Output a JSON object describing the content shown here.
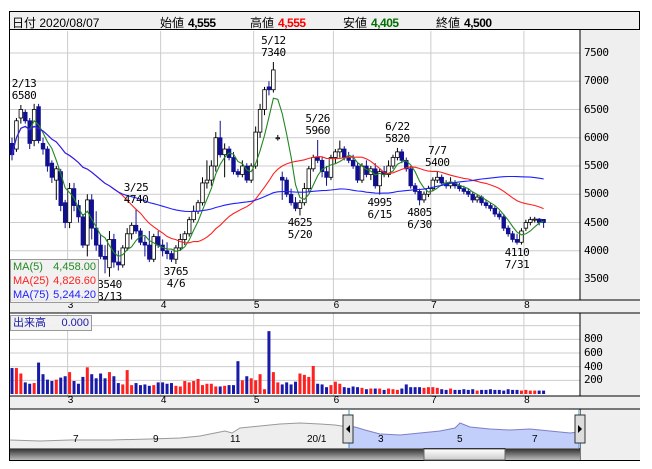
{
  "header": {
    "date_label": "日付",
    "date": "2020/08/07",
    "open_label": "始値",
    "open": "4,555",
    "high_label": "高値",
    "high": "4,555",
    "low_label": "安値",
    "low": "4,405",
    "close_label": "終値",
    "close": "4,500"
  },
  "colors": {
    "up_volume": "#ff2020",
    "down_volume": "#1a1aa8",
    "down_candle": "#101090",
    "ma5": "#228822",
    "ma25": "#ff2020",
    "ma75": "#2020ff",
    "high_text": "#ff0000",
    "low_text": "#007000"
  },
  "ma_legend": [
    {
      "label": "MA(5)",
      "value": "4,458.00"
    },
    {
      "label": "MA(25)",
      "value": "4,826.60"
    },
    {
      "label": "MA(75)",
      "value": "5,244.20"
    }
  ],
  "volume_legend": {
    "label": "出来高",
    "value": "0.000"
  },
  "navigator": {
    "labels": [
      "7",
      "9",
      "11",
      "20/1",
      "3",
      "5",
      "7"
    ]
  },
  "chart_data": {
    "type": "candlestick",
    "price_ticks": [
      "3500",
      "4000",
      "4500",
      "5000",
      "5500",
      "6000",
      "6500",
      "7000",
      "7500"
    ],
    "ylim": [
      3500,
      7500
    ],
    "volume_ticks": [
      "200",
      "400",
      "600",
      "800"
    ],
    "volume_ylim": [
      0,
      900
    ],
    "months": [
      {
        "label": "3",
        "start_index": 13
      },
      {
        "label": "4",
        "start_index": 34
      },
      {
        "label": "5",
        "start_index": 55
      },
      {
        "label": "6",
        "start_index": 73
      },
      {
        "label": "7",
        "start_index": 95
      },
      {
        "label": "8",
        "start_index": 116
      }
    ],
    "ma_periods": [
      5,
      25,
      75
    ],
    "ohlcv_fields": [
      "open",
      "high",
      "low",
      "close",
      "volume"
    ],
    "ohlcv": [
      [
        5900,
        6000,
        5600,
        5700,
        380
      ],
      [
        5800,
        6350,
        5750,
        6300,
        380
      ],
      [
        6350,
        6580,
        6250,
        6500,
        300
      ],
      [
        6450,
        6500,
        6250,
        6300,
        170
      ],
      [
        6300,
        6350,
        5800,
        5900,
        150
      ],
      [
        5950,
        6600,
        5850,
        6500,
        160
      ],
      [
        6550,
        6600,
        5900,
        5950,
        460
      ],
      [
        5900,
        6000,
        5700,
        5800,
        290
      ],
      [
        5800,
        5850,
        5400,
        5500,
        210
      ],
      [
        5550,
        5600,
        5200,
        5300,
        190
      ],
      [
        5250,
        5500,
        4900,
        5450,
        210
      ],
      [
        5400,
        5450,
        4700,
        4800,
        240
      ],
      [
        4850,
        4900,
        4400,
        4500,
        260
      ],
      [
        4500,
        5200,
        4400,
        5100,
        320
      ],
      [
        5100,
        5200,
        4700,
        4800,
        190
      ],
      [
        4800,
        4900,
        4500,
        4600,
        150
      ],
      [
        4600,
        4650,
        4050,
        4100,
        250
      ],
      [
        4100,
        5000,
        3900,
        4900,
        390
      ],
      [
        4900,
        5000,
        4200,
        4400,
        290
      ],
      [
        4400,
        4700,
        4000,
        4100,
        230
      ],
      [
        4100,
        4300,
        3850,
        3900,
        300
      ],
      [
        3900,
        4100,
        3600,
        3850,
        230
      ],
      [
        3700,
        4350,
        3540,
        4200,
        320
      ],
      [
        4200,
        4300,
        3700,
        3800,
        260
      ],
      [
        3800,
        4000,
        3650,
        3750,
        160
      ],
      [
        3750,
        4100,
        3700,
        4050,
        140
      ],
      [
        4050,
        4400,
        4000,
        4300,
        350
      ],
      [
        4300,
        4500,
        4200,
        4450,
        130
      ],
      [
        4450,
        4740,
        4300,
        4350,
        160
      ],
      [
        4350,
        4400,
        4100,
        4150,
        130
      ],
      [
        4150,
        4250,
        3900,
        4100,
        140
      ],
      [
        4100,
        4350,
        3800,
        3850,
        120
      ],
      [
        3850,
        4300,
        3800,
        4250,
        130
      ],
      [
        4250,
        4350,
        4050,
        4100,
        170
      ],
      [
        4100,
        4200,
        3900,
        4000,
        170
      ],
      [
        4000,
        4150,
        3850,
        3950,
        150
      ],
      [
        3950,
        4000,
        3800,
        3850,
        160
      ],
      [
        3850,
        4100,
        3765,
        4050,
        120
      ],
      [
        4050,
        4300,
        4000,
        4200,
        110
      ],
      [
        4200,
        4350,
        4100,
        4300,
        190
      ],
      [
        4300,
        4600,
        4250,
        4550,
        170
      ],
      [
        4550,
        4800,
        4500,
        4700,
        190
      ],
      [
        4700,
        4900,
        4650,
        4850,
        220
      ],
      [
        4850,
        5300,
        4800,
        5200,
        130
      ],
      [
        5200,
        5600,
        5100,
        5250,
        150
      ],
      [
        5250,
        5600,
        5150,
        5500,
        150
      ],
      [
        5500,
        6100,
        5400,
        6000,
        110
      ],
      [
        6000,
        6300,
        5650,
        5700,
        110
      ],
      [
        5700,
        5900,
        5300,
        5800,
        120
      ],
      [
        5800,
        5850,
        5600,
        5650,
        130
      ],
      [
        5650,
        5750,
        5350,
        5400,
        130
      ],
      [
        5400,
        5450,
        5300,
        5350,
        480
      ],
      [
        5350,
        5600,
        5300,
        5500,
        200
      ],
      [
        5500,
        5550,
        5200,
        5250,
        260
      ],
      [
        5250,
        5550,
        5200,
        5500,
        230
      ],
      [
        5500,
        6200,
        5450,
        6100,
        200
      ],
      [
        6100,
        6600,
        6000,
        6500,
        290
      ],
      [
        6500,
        6900,
        6400,
        6850,
        70
      ],
      [
        6900,
        7000,
        6750,
        6850,
        920
      ],
      [
        6850,
        7340,
        6800,
        7200,
        320
      ],
      [
        6000,
        6050,
        5950,
        6000,
        170
      ],
      [
        5300,
        5400,
        4900,
        5250,
        140
      ],
      [
        5250,
        5300,
        4950,
        5000,
        170
      ],
      [
        5000,
        5100,
        4800,
        4850,
        140
      ],
      [
        4850,
        4950,
        4700,
        4750,
        180
      ],
      [
        4750,
        4900,
        4625,
        4850,
        300
      ],
      [
        4850,
        5200,
        4800,
        5100,
        280
      ],
      [
        5100,
        5500,
        5050,
        5450,
        250
      ],
      [
        5450,
        5700,
        5400,
        5650,
        410
      ],
      [
        5650,
        5960,
        5550,
        5600,
        150
      ],
      [
        5600,
        5650,
        5300,
        5400,
        140
      ],
      [
        5400,
        5500,
        5150,
        5300,
        100
      ],
      [
        5300,
        5700,
        5250,
        5650,
        130
      ],
      [
        5650,
        5800,
        5550,
        5750,
        180
      ],
      [
        5750,
        5950,
        5650,
        5800,
        150
      ],
      [
        5800,
        5850,
        5600,
        5650,
        100
      ],
      [
        5650,
        5750,
        5550,
        5600,
        90
      ],
      [
        5600,
        5700,
        5450,
        5500,
        110
      ],
      [
        5500,
        5550,
        5200,
        5250,
        100
      ],
      [
        5250,
        5550,
        5200,
        5500,
        90
      ],
      [
        5500,
        5600,
        5300,
        5350,
        70
      ],
      [
        5350,
        5500,
        5250,
        5450,
        80
      ],
      [
        5450,
        5550,
        5100,
        5150,
        80
      ],
      [
        5150,
        5450,
        4995,
        5400,
        80
      ],
      [
        5400,
        5500,
        5300,
        5350,
        60
      ],
      [
        5350,
        5600,
        5300,
        5500,
        80
      ],
      [
        5500,
        5700,
        5450,
        5650,
        70
      ],
      [
        5650,
        5820,
        5600,
        5750,
        60
      ],
      [
        5750,
        5800,
        5550,
        5600,
        80
      ],
      [
        5600,
        5650,
        5400,
        5450,
        140
      ],
      [
        5450,
        5500,
        5100,
        5150,
        100
      ],
      [
        5150,
        5200,
        5000,
        5050,
        100
      ],
      [
        5050,
        5100,
        4805,
        4900,
        100
      ],
      [
        4900,
        5050,
        4850,
        5000,
        90
      ],
      [
        5000,
        5150,
        4950,
        5100,
        100
      ],
      [
        5100,
        5300,
        5050,
        5250,
        100
      ],
      [
        5250,
        5400,
        5200,
        5300,
        90
      ],
      [
        5300,
        5350,
        5150,
        5200,
        70
      ],
      [
        5200,
        5250,
        5100,
        5150,
        60
      ],
      [
        5150,
        5300,
        5100,
        5200,
        80
      ],
      [
        5200,
        5250,
        5100,
        5150,
        60
      ],
      [
        5150,
        5200,
        5050,
        5100,
        60
      ],
      [
        5100,
        5150,
        5000,
        5050,
        70
      ],
      [
        5050,
        5100,
        4950,
        5000,
        60
      ],
      [
        5000,
        5050,
        4850,
        4900,
        70
      ],
      [
        4900,
        5000,
        4850,
        4950,
        50
      ],
      [
        4950,
        4980,
        4800,
        4850,
        60
      ],
      [
        4850,
        4900,
        4750,
        4800,
        60
      ],
      [
        4800,
        4850,
        4700,
        4750,
        70
      ],
      [
        4750,
        4800,
        4600,
        4650,
        60
      ],
      [
        4650,
        4700,
        4550,
        4600,
        60
      ],
      [
        4600,
        4650,
        4350,
        4400,
        50
      ],
      [
        4400,
        4450,
        4250,
        4300,
        70
      ],
      [
        4300,
        4350,
        4150,
        4200,
        60
      ],
      [
        4200,
        4300,
        4110,
        4150,
        60
      ],
      [
        4150,
        4400,
        4110,
        4350,
        50
      ],
      [
        4400,
        4550,
        4350,
        4500,
        60
      ],
      [
        4500,
        4600,
        4450,
        4550,
        50
      ],
      [
        4550,
        4600,
        4500,
        4560,
        50
      ],
      [
        4560,
        4580,
        4450,
        4500,
        50
      ],
      [
        4555,
        4555,
        4405,
        4500,
        50
      ]
    ],
    "annotations": [
      {
        "text": "2/13\n6580",
        "index": 2,
        "price": 6580,
        "side": "above"
      },
      {
        "text": "3540\n3/13",
        "index": 22,
        "price": 3540,
        "side": "below"
      },
      {
        "text": "3/25\n4740",
        "index": 28,
        "price": 4740,
        "side": "above"
      },
      {
        "text": "3765\n4/6",
        "index": 37,
        "price": 3765,
        "side": "below"
      },
      {
        "text": "5/12\n7340",
        "index": 59,
        "price": 7340,
        "side": "above"
      },
      {
        "text": "4625\n5/20",
        "index": 65,
        "price": 4625,
        "side": "below"
      },
      {
        "text": "5/26\n5960",
        "index": 69,
        "price": 5960,
        "side": "above"
      },
      {
        "text": "4995\n6/15",
        "index": 83,
        "price": 4995,
        "side": "below"
      },
      {
        "text": "6/22\n5820",
        "index": 87,
        "price": 5820,
        "side": "above"
      },
      {
        "text": "4805\n6/30",
        "index": 92,
        "price": 4805,
        "side": "below"
      },
      {
        "text": "7/7\n5400",
        "index": 96,
        "price": 5400,
        "side": "above"
      },
      {
        "text": "4110\n7/31",
        "index": 114,
        "price": 4110,
        "side": "below"
      }
    ]
  }
}
